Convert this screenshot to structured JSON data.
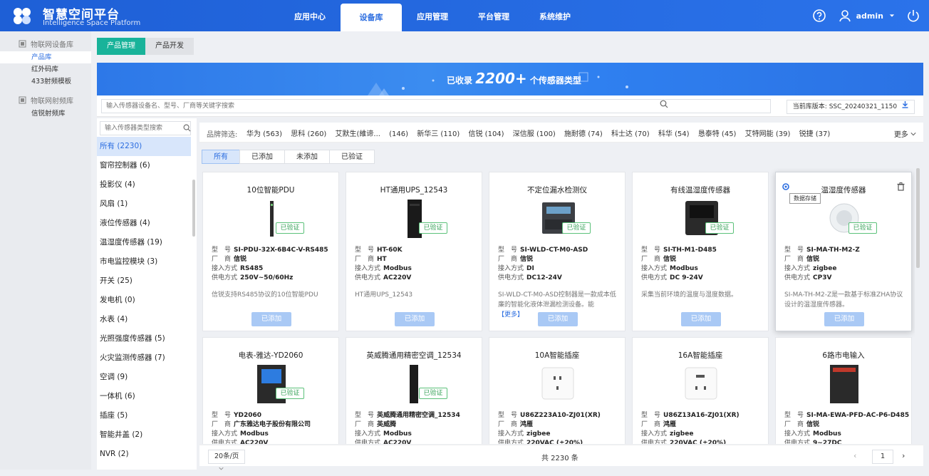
{
  "app": {
    "title": "智慧空间平台",
    "subtitle": "Intelligence Space Platform"
  },
  "nav": [
    "应用中心",
    "设备库",
    "应用管理",
    "平台管理",
    "系统维护"
  ],
  "user": {
    "name": "admin"
  },
  "sidebar": {
    "groups": [
      {
        "label": "物联网设备库",
        "items": [
          "产品库",
          "红外码库",
          "433射频模板"
        ]
      },
      {
        "label": "物联网射频库",
        "items": [
          "信锐射频库"
        ]
      }
    ]
  },
  "tabs": [
    "产品管理",
    "产品开发"
  ],
  "banner": {
    "prefix": "已收录",
    "number": "2200+",
    "suffix": "个传感器类型"
  },
  "search": {
    "placeholder": "输入传感器设备名、型号、厂商等关键字搜索"
  },
  "version": "当前库版本: SSC_20240321_1150",
  "category_search": {
    "placeholder": "输入传感器类型搜索"
  },
  "categories": [
    "所有 (2230)",
    "窗帘控制器 (6)",
    "投影仪 (4)",
    "风扇 (1)",
    "液位传感器 (4)",
    "温湿度传感器 (19)",
    "市电监控模块 (3)",
    "开关 (25)",
    "发电机 (0)",
    "水表 (4)",
    "光照强度传感器 (5)",
    "火灾监测传感器 (7)",
    "空调 (9)",
    "一体机 (6)",
    "插座 (5)",
    "智能井盖 (2)",
    "NVR (2)"
  ],
  "brand_filter": {
    "label": "品牌筛选:",
    "brands": [
      "华为 (563)",
      "思科 (260)",
      "艾默生(維谛...",
      "(146)",
      "新华三 (110)",
      "信锐 (104)",
      "深信服 (100)",
      "施耐德 (74)",
      "科士达 (70)",
      "科华 (54)",
      "恳泰特 (45)",
      "艾特网能 (39)",
      "锐捷 (37)"
    ],
    "more": "更多"
  },
  "filters": [
    "所有",
    "已添加",
    "未添加",
    "已验证"
  ],
  "labels": {
    "model": "型　号",
    "vendor": "厂　商",
    "access": "接入方式",
    "power": "供电方式",
    "verified": "已验证",
    "added": "已添加",
    "more_link": "【更多】",
    "tooltip": "数据存储"
  },
  "products": [
    {
      "name": "10位智能PDU",
      "model": "SI-PDU-32X-6B4C-V-RS485",
      "vendor": "信锐",
      "access": "RS485",
      "power": "250V~50/60Hz",
      "desc": "信锐支持RS485协议的10位智能PDU",
      "more": false
    },
    {
      "name": "HT通用UPS_12543",
      "model": "HT-60K",
      "vendor": "HT",
      "access": "Modbus",
      "power": "AC220V",
      "desc": "HT通用UPS_12543",
      "more": false
    },
    {
      "name": "不定位漏水检测仪",
      "model": "SI-WLD-CT-M0-ASD",
      "vendor": "信锐",
      "access": "DI",
      "power": "DC12-24V",
      "desc": "SI-WLD-CT-M0-ASD控制器是一款成本低廉的智能化液体泄漏检测设备。能",
      "more": true
    },
    {
      "name": "有线温湿度传感器",
      "model": "SI-TH-M1-D485",
      "vendor": "信锐",
      "access": "Modbus",
      "power": "DC 9-24V",
      "desc": "采集当前环境的温度与湿度数据。",
      "more": false
    },
    {
      "name": "温湿度传感器",
      "model": "SI-MA-TH-M2-Z",
      "vendor": "信锐",
      "access": "zigbee",
      "power": "CP3V",
      "desc": "SI-MA-TH-M2-Z是一款基于标准ZHA协议设计的温湿度传感器。",
      "more": false
    },
    {
      "name": "电表-雅达-YD2060",
      "model": "YD2060",
      "vendor": "广东雅达电子股份有限公司",
      "access": "Modbus",
      "power": "AC220V",
      "desc": "",
      "more": false
    },
    {
      "name": "英威腾通用精密空调_12534",
      "model": "英威腾通用精密空调_12534",
      "vendor": "英威腾",
      "access": "Modbus",
      "power": "AC220V",
      "desc": "",
      "more": false
    },
    {
      "name": "10A智能插座",
      "model": "U86Z223A10-ZJ01(XR)",
      "vendor": "鸿雁",
      "access": "zigbee",
      "power": "220VAC (±20%)",
      "desc": "",
      "more": false
    },
    {
      "name": "16A智能插座",
      "model": "U86Z13A16-ZJ01(XR)",
      "vendor": "鸿雁",
      "access": "zigbee",
      "power": "220VAC (±20%)",
      "desc": "",
      "more": false
    },
    {
      "name": "6路市电输入",
      "model": "SI-MA-EWA-PFD-AC-P6-D485",
      "vendor": "信锐",
      "access": "Modbus",
      "power": "9~27DC",
      "desc": "",
      "more": false
    }
  ],
  "pager": {
    "size": "20条/页",
    "total": "共 2230 条",
    "current": "1"
  },
  "colors": {
    "topbar": "#2b73ea",
    "accent": "#2b6de0",
    "tab_active": "#19b39a",
    "verified": "#3aa45b"
  }
}
